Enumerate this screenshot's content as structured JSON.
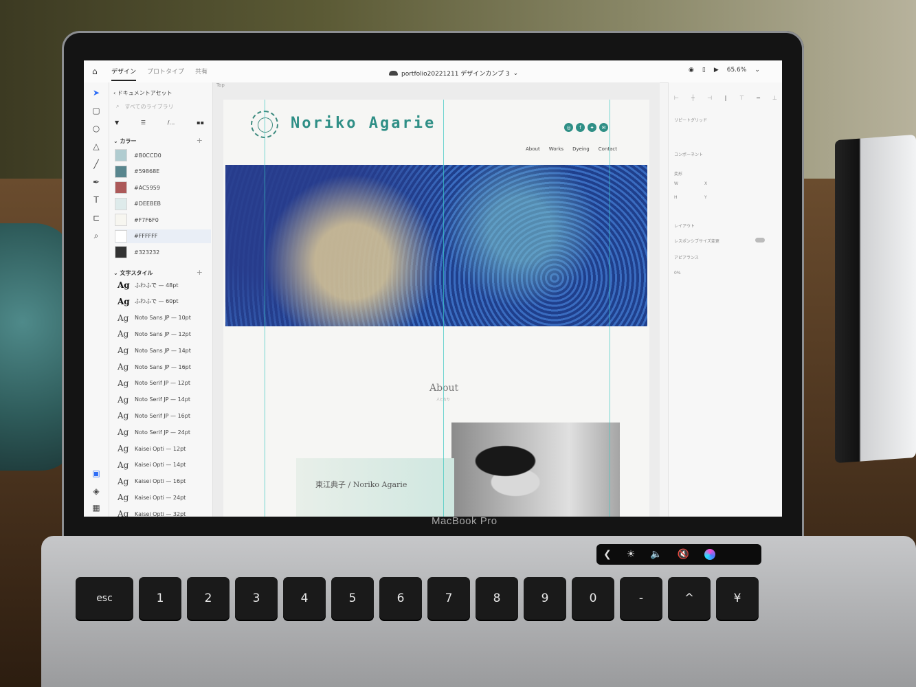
{
  "device": {
    "brand": "MacBook Pro"
  },
  "app": {
    "tabs": [
      {
        "label": "デザイン",
        "active": true
      },
      {
        "label": "プロトタイプ",
        "active": false
      },
      {
        "label": "共有",
        "active": false
      }
    ],
    "document_title": "portfolio20221211 デザインカンプ 3",
    "zoom": "65.6%"
  },
  "assets_panel": {
    "header": "ドキュメントアセット",
    "search_placeholder": "すべてのライブラリ",
    "colors_title": "カラー",
    "colors": [
      {
        "hex": "#B0CCD0",
        "swatch": "#B0CCD0",
        "selected": false
      },
      {
        "hex": "#59868E",
        "swatch": "#59868E",
        "selected": false
      },
      {
        "hex": "#AC5959",
        "swatch": "#AC5959",
        "selected": false
      },
      {
        "hex": "#DEEBEB",
        "swatch": "#DEEBEB",
        "selected": false
      },
      {
        "hex": "#F7F6F0",
        "swatch": "#F7F6F0",
        "selected": false
      },
      {
        "hex": "#FFFFFF",
        "swatch": "#FFFFFF",
        "selected": true
      },
      {
        "hex": "#323232",
        "swatch": "#323232",
        "selected": false
      }
    ],
    "text_styles_title": "文字スタイル",
    "text_styles": [
      {
        "sample": "Ag",
        "label": "ふわふで — 48pt",
        "bold": true
      },
      {
        "sample": "Ag",
        "label": "ふわふで — 60pt",
        "bold": true
      },
      {
        "sample": "Ag",
        "label": "Noto Sans JP — 10pt",
        "bold": false
      },
      {
        "sample": "Ag",
        "label": "Noto Sans JP — 12pt",
        "bold": false
      },
      {
        "sample": "Ag",
        "label": "Noto Sans JP — 14pt",
        "bold": false
      },
      {
        "sample": "Ag",
        "label": "Noto Sans JP — 16pt",
        "bold": false
      },
      {
        "sample": "Ag",
        "label": "Noto Serif JP — 12pt",
        "bold": false
      },
      {
        "sample": "Ag",
        "label": "Noto Serif JP — 14pt",
        "bold": false
      },
      {
        "sample": "Ag",
        "label": "Noto Serif JP — 16pt",
        "bold": false
      },
      {
        "sample": "Ag",
        "label": "Noto Serif JP — 24pt",
        "bold": false
      },
      {
        "sample": "Ag",
        "label": "Kaisei Opti — 12pt",
        "bold": false
      },
      {
        "sample": "Ag",
        "label": "Kaisei Opti — 14pt",
        "bold": false
      },
      {
        "sample": "Ag",
        "label": "Kaisei Opti — 16pt",
        "bold": false
      },
      {
        "sample": "Ag",
        "label": "Kaisei Opti — 24pt",
        "bold": false
      },
      {
        "sample": "Ag",
        "label": "Kaisei Opti — 32pt",
        "bold": false
      }
    ]
  },
  "canvas": {
    "artboard_label": "Top",
    "site": {
      "name": "Noriko Agarie",
      "nav": [
        "About",
        "Works",
        "Dyeing",
        "Contact"
      ],
      "social_icons": [
        "instagram-icon",
        "facebook-icon",
        "twitter-icon",
        "mail-icon"
      ],
      "about_title": "About",
      "about_subtitle": "人となり",
      "name_line": "東江典子 / Noriko Agarie"
    },
    "accent_color": "#2F8F86",
    "guide_color": "#39C7C0"
  },
  "inspector": {
    "repeat_grid": "リピートグリッド",
    "component": "コンポーネント",
    "transform": "変形",
    "w": "W",
    "h": "H",
    "x": "X",
    "y": "Y",
    "layout": "レイアウト",
    "responsive": "レスポンシブサイズ変更",
    "appearance": "アピアランス",
    "opacity": "0%"
  },
  "keyboard": {
    "touchbar": [
      "❮",
      "☀",
      "🔈",
      "🔇"
    ],
    "keys": [
      "esc",
      "1",
      "2",
      "3",
      "4",
      "5",
      "6",
      "7",
      "8",
      "9",
      "0",
      "-",
      "^",
      "¥"
    ]
  }
}
